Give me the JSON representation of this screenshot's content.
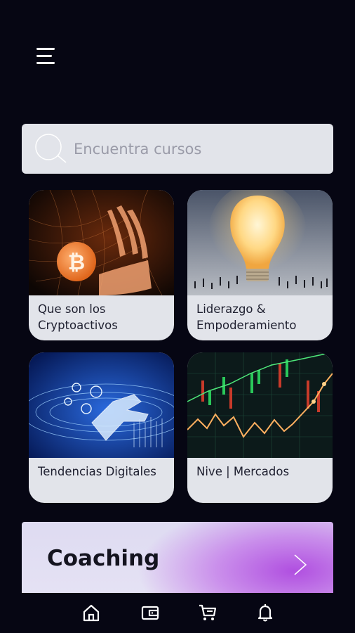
{
  "search": {
    "placeholder": "Encuentra cursos",
    "value": ""
  },
  "courses": [
    {
      "label": "Que son los Cryptoactivos"
    },
    {
      "label": "Liderazgo & Empoderamiento"
    },
    {
      "label": "Tendencias Digitales"
    },
    {
      "label": "Nive | Mercados"
    }
  ],
  "banner": {
    "title": "Coaching"
  },
  "nav": {
    "items": [
      "home-icon",
      "wallet-icon",
      "cart-icon",
      "bell-icon"
    ]
  },
  "colors": {
    "background": "#060613",
    "card": "#e2e4ea",
    "accent": "#b04fe0"
  }
}
